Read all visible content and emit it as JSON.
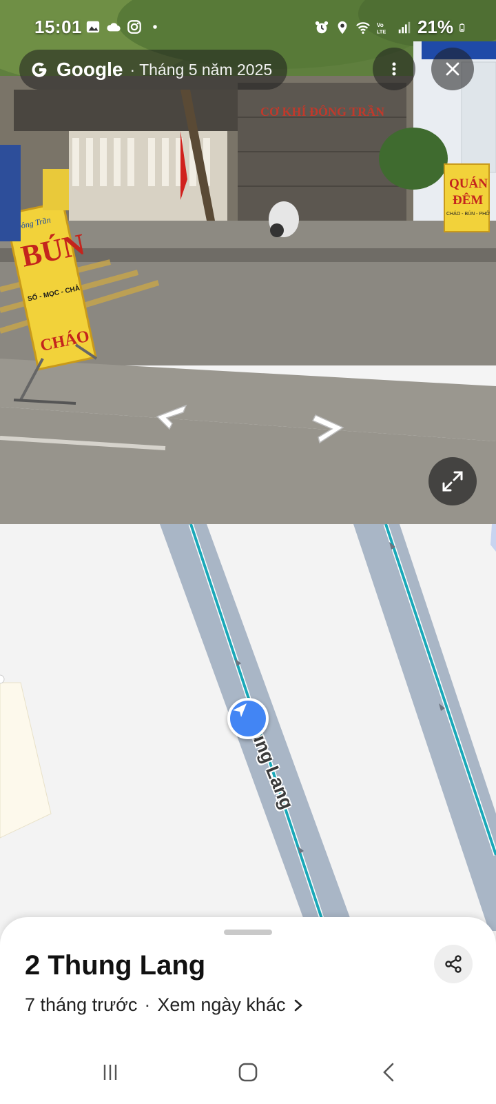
{
  "status_bar": {
    "time": "15:01",
    "battery": "21%",
    "left_icons": [
      "gallery-icon",
      "cloud-icon",
      "instagram-icon",
      "dot-icon"
    ],
    "right_icons": [
      "alarm-icon",
      "location-icon",
      "wifi-icon",
      "volte-icon",
      "signal-icon",
      "battery-icon"
    ]
  },
  "street_view": {
    "brand": "Google",
    "date": "· Tháng 5 năm 2025",
    "buttons": [
      "more-icon",
      "close-icon",
      "expand-icon"
    ],
    "scene_text": {
      "sign_left_brand": "Đông Trần",
      "sign_left_main": "BÚN",
      "sign_left_sub": "SỐ - MỌC - CHẢ",
      "sign_left_bottom": "CHÁO",
      "shop_banner": "CƠ KHÍ ĐÔNG TRẦN",
      "sign_right_line1": "QUÁN",
      "sign_right_line2": "ĐÊM",
      "sign_right_small": "CHÁO - BÚN - PHỞ"
    }
  },
  "map": {
    "road_label": "ung Lang",
    "colors": {
      "road": "#a9b6c6",
      "route": "#19a8b8",
      "background": "#f3f3f3",
      "marker": "#4285f4"
    }
  },
  "place": {
    "title": "2 Thung Lang",
    "age": "7 tháng trước",
    "separator": "·",
    "other_dates_link": "Xem ngày khác"
  },
  "nav_bar": {
    "items": [
      "recents-icon",
      "home-icon",
      "back-icon"
    ]
  }
}
